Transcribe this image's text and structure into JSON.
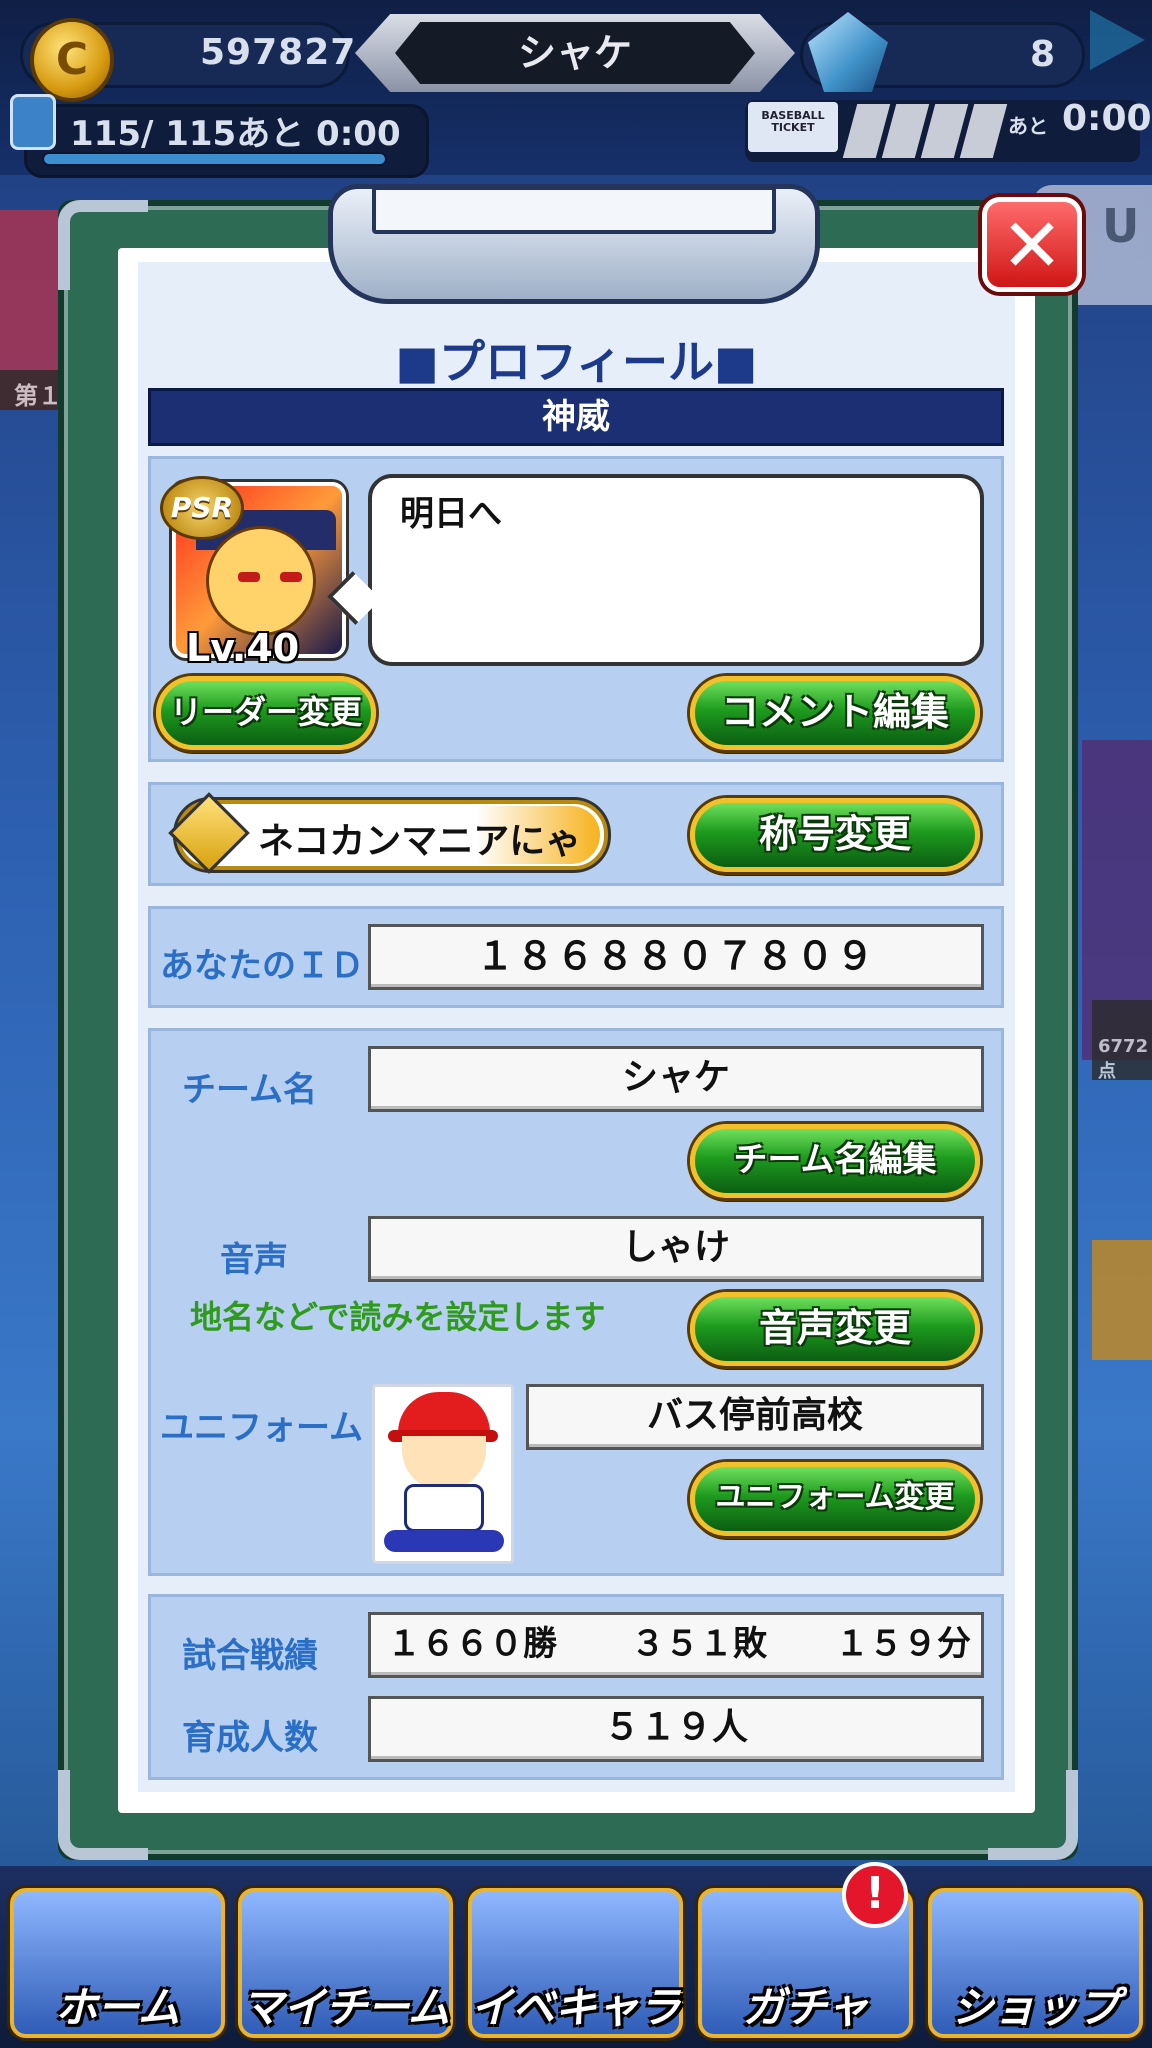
{
  "topbar": {
    "coins": "597827",
    "team_name": "シャケ",
    "gems": "8",
    "stamina": "115/ 115あと 0:00",
    "ticket_label": "BASEBALL TICKET",
    "ticket_ato": "あと",
    "ticket_time": "0:00"
  },
  "background": {
    "left_label": "第１",
    "right_label": "6772点"
  },
  "profile": {
    "title": "■プロフィール■",
    "player_name": "神威",
    "avatar_badge": "PSR",
    "avatar_level": "Lv.40",
    "comment": "明日へ",
    "leader_change_label": "リーダー変更",
    "comment_edit_label": "コメント編集",
    "title_badge_text": "ネコカンマニアにゃ",
    "title_change_label": "称号変更",
    "id_label": "あなたのＩＤ",
    "id_value": "１８６８８０７８０９",
    "team_label": "チーム名",
    "team_value": "シャケ",
    "team_edit_label": "チーム名編集",
    "voice_label": "音声",
    "voice_value": "しゃけ",
    "voice_note": "地名などで読みを設定します",
    "voice_change_label": "音声変更",
    "uniform_label": "ユニフォーム",
    "uniform_value": "バス停前高校",
    "uniform_change_label": "ユニフォーム変更",
    "record_label": "試合戦績",
    "record_wins": "１６６０勝",
    "record_losses": "３５１敗",
    "record_draws": "１５９分",
    "trained_label": "育成人数",
    "trained_value": "５１９人"
  },
  "bottom_nav": {
    "items": [
      {
        "label": "ホーム"
      },
      {
        "label": "マイチーム"
      },
      {
        "label": "イベキャラ"
      },
      {
        "label": "ガチャ"
      },
      {
        "label": "ショップ"
      }
    ],
    "alert": "!"
  },
  "colors": {
    "accent_blue": "#1b2f72",
    "button_green": "#1e9b1e",
    "label_blue": "#2a6fc5",
    "note_green": "#2f9a1e",
    "close_red": "#d01515"
  }
}
